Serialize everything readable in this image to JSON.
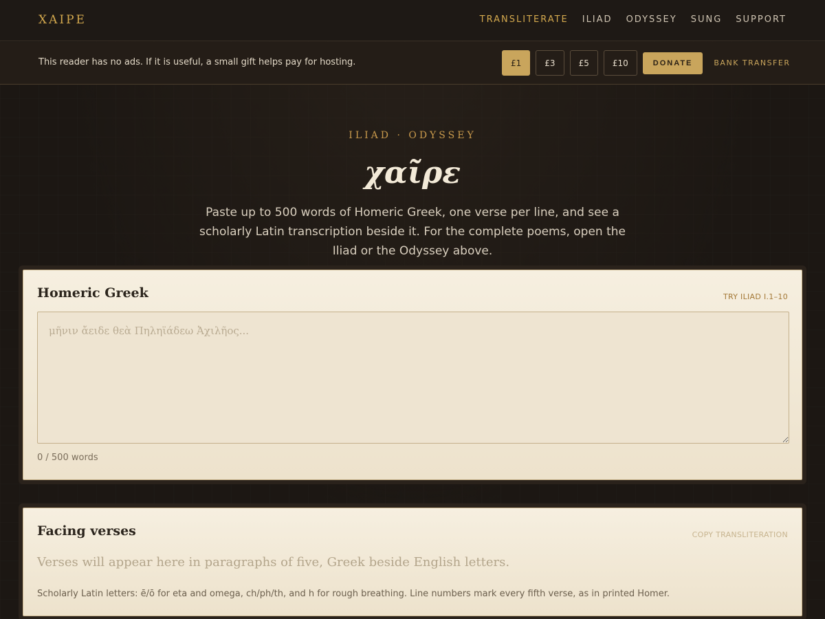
{
  "nav": {
    "brand": "ΧΑΙΡΕ",
    "links": [
      {
        "label": "TRANSLITERATE",
        "active": true
      },
      {
        "label": "ILIAD",
        "active": false
      },
      {
        "label": "ODYSSEY",
        "active": false
      },
      {
        "label": "SUNG",
        "active": false
      },
      {
        "label": "SUPPORT",
        "active": false
      }
    ]
  },
  "donate": {
    "message": "This reader has no ads. If it is useful, a small gift helps pay for hosting.",
    "amounts": [
      "£1",
      "£3",
      "£5",
      "£10"
    ],
    "selected_amount": "£1",
    "donate_label": "DONATE",
    "bank_label": "BANK TRANSFER"
  },
  "hero": {
    "kicker": "ILIAD · ODYSSEY",
    "title": "χαῖρε",
    "subtitle": "Paste up to 500 words of Homeric Greek, one verse per line, and see a scholarly Latin transcription beside it. For the complete poems, open the Iliad or the Odyssey above."
  },
  "input_panel": {
    "title": "Homeric Greek",
    "try_label": "TRY ILIAD I.1–10",
    "placeholder": "μῆνιν ἄειδε θεὰ Πηληϊάδεω Ἀχιλῆος...",
    "value": "",
    "word_count": "0 / 500 words"
  },
  "output_panel": {
    "title": "Facing verses",
    "copy_label": "COPY TRANSLITERATION",
    "placeholder": "Verses will appear here in paragraphs of five, Greek beside English letters.",
    "note": "Scholarly Latin letters: ē/ō for eta and omega, ch/ph/th, and h for rough breathing. Line numbers mark every fifth verse, as in printed Homer."
  },
  "colors": {
    "background": "#1c1713",
    "accent": "#c9a55c",
    "panel": "#f6efe0"
  }
}
